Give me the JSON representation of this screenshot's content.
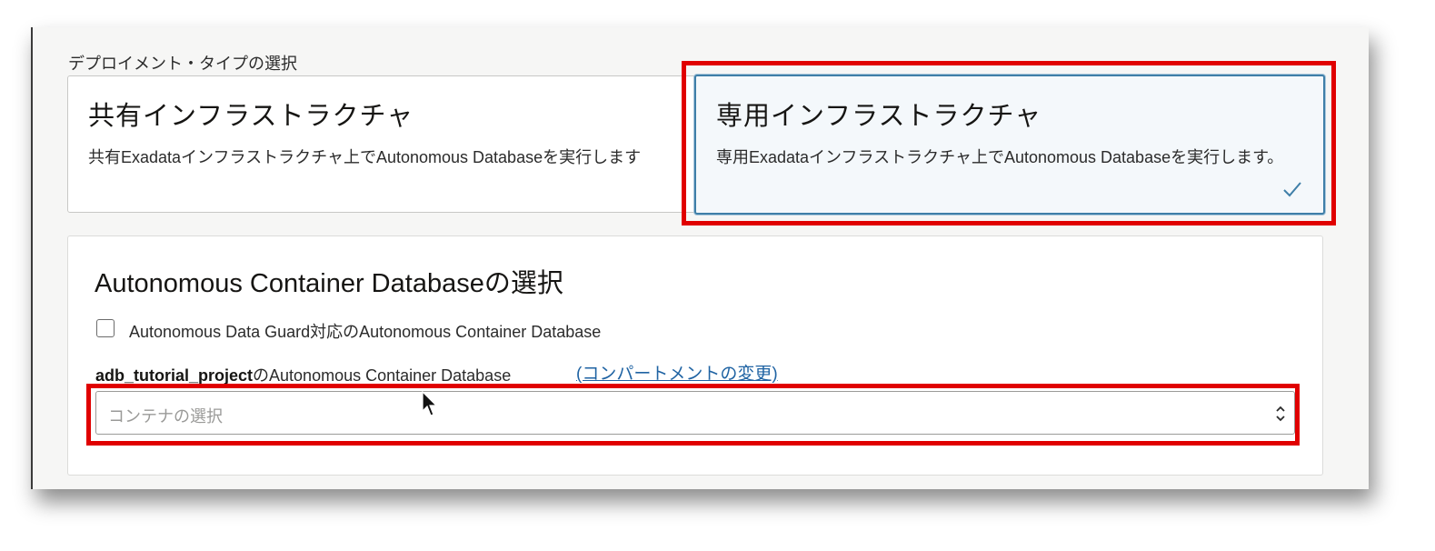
{
  "deployment": {
    "section_label": "デプロイメント・タイプの選択",
    "shared": {
      "title": "共有インフラストラクチャ",
      "description": "共有Exadataインフラストラクチャ上でAutonomous Databaseを実行します"
    },
    "dedicated": {
      "title": "専用インフラストラクチャ",
      "description": "専用Exadataインフラストラクチャ上でAutonomous Databaseを実行します。",
      "selected": true
    }
  },
  "container": {
    "title": "Autonomous Container Databaseの選択",
    "data_guard_label": "Autonomous Data Guard対応のAutonomous Container Database",
    "data_guard_checked": false,
    "field_label_bold": "adb_tutorial_project",
    "field_label_rest": "のAutonomous Container Database",
    "change_compartment_link": "(コンパートメントの変更)",
    "select_placeholder": "コンテナの選択"
  },
  "colors": {
    "highlight": "#e00000",
    "link": "#1f63a3",
    "selected_border": "#3f7fa8"
  }
}
